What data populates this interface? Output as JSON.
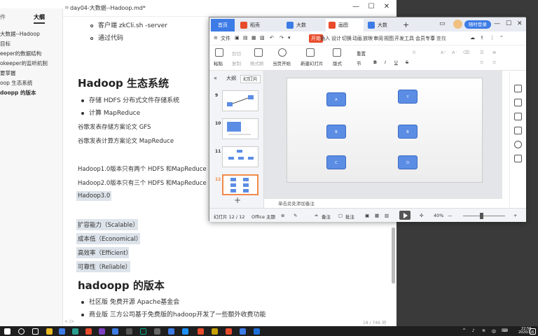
{
  "editor": {
    "title": "day04-大数据--Hadoop.md*",
    "menu_label": "=",
    "sidebar": {
      "tabs": [
        "件",
        "大纲"
      ],
      "items": [
        "大数据--Hadoop",
        "目标",
        "eeper的数据结构",
        "okeeper的监听机制",
        "要掌握",
        "oop 生态系统",
        "doopp 的版本"
      ]
    },
    "content": {
      "li_client": "客户端 zkCli.sh -server",
      "li_code": "通过代码",
      "h_eco": "Hadoop 生态系统",
      "li_storage": "存储 HDFS 分布式文件存储系统",
      "li_compute": "计算 MapReduce",
      "p_gfs": "谷歌发表存储方案论文 GFS",
      "p_mr": "谷歌发表计算方案论文 MapReduce",
      "p_h1": "Hadoop1.0版本只有两个 HDFS 和MapReduce",
      "p_h2": "Hadoop2.0版本只有三个 HDFS 和MapReduce",
      "hl_h3": "Hadoop3.0",
      "hl_scalable": "扩容能力（Scalable）",
      "hl_economical": "成本低（Economical）",
      "hl_efficient": "高效率（Efficient）",
      "hl_reliable": "可靠性（Reliable）",
      "h_ver": "hadoopp 的版本",
      "li_community": "社区版 免费开源 Apache基金会",
      "li_commercial": "商业版 三方公司基于免费版的hadoop开发了一些额外收费功能"
    },
    "status_left": "< />",
    "status_right": "18 / 746 词"
  },
  "wps": {
    "tabs": [
      "首页",
      "稻壳",
      "大数",
      "画图",
      "大数"
    ],
    "login_label": "随时登录",
    "menu": [
      "文件",
      "开始",
      "插入",
      "设计",
      "切换",
      "动画",
      "放映",
      "审阅",
      "视图",
      "开发工具",
      "会员专享"
    ],
    "search_label": "Q 查找",
    "toolbar": {
      "paste": "粘贴",
      "cut": "剪切",
      "copy": "复制",
      "format_painter": "格式刷",
      "from_current": "当页开始",
      "new_slide": "新建幻灯片",
      "layout": "版式",
      "section": "节",
      "reset": "重置",
      "font_size": "0",
      "bold": "B",
      "italic": "I",
      "underline": "U",
      "strike": "S"
    },
    "left_tabs": [
      "大纲",
      "幻灯片"
    ],
    "slide_nums": [
      "9",
      "10",
      "11",
      "12"
    ],
    "slide_nodes": [
      "A",
      "B",
      "C",
      "Y",
      "B",
      "D"
    ],
    "note_placeholder": "单击此处添加备注",
    "status": {
      "slide_count": "幻灯片 12 / 12",
      "theme": "Office 主题",
      "notes": "备注",
      "comments": "批注",
      "zoom": "40%"
    }
  },
  "taskbar": {
    "ime": "中",
    "time": "22:56",
    "date": "2020/1/6"
  }
}
